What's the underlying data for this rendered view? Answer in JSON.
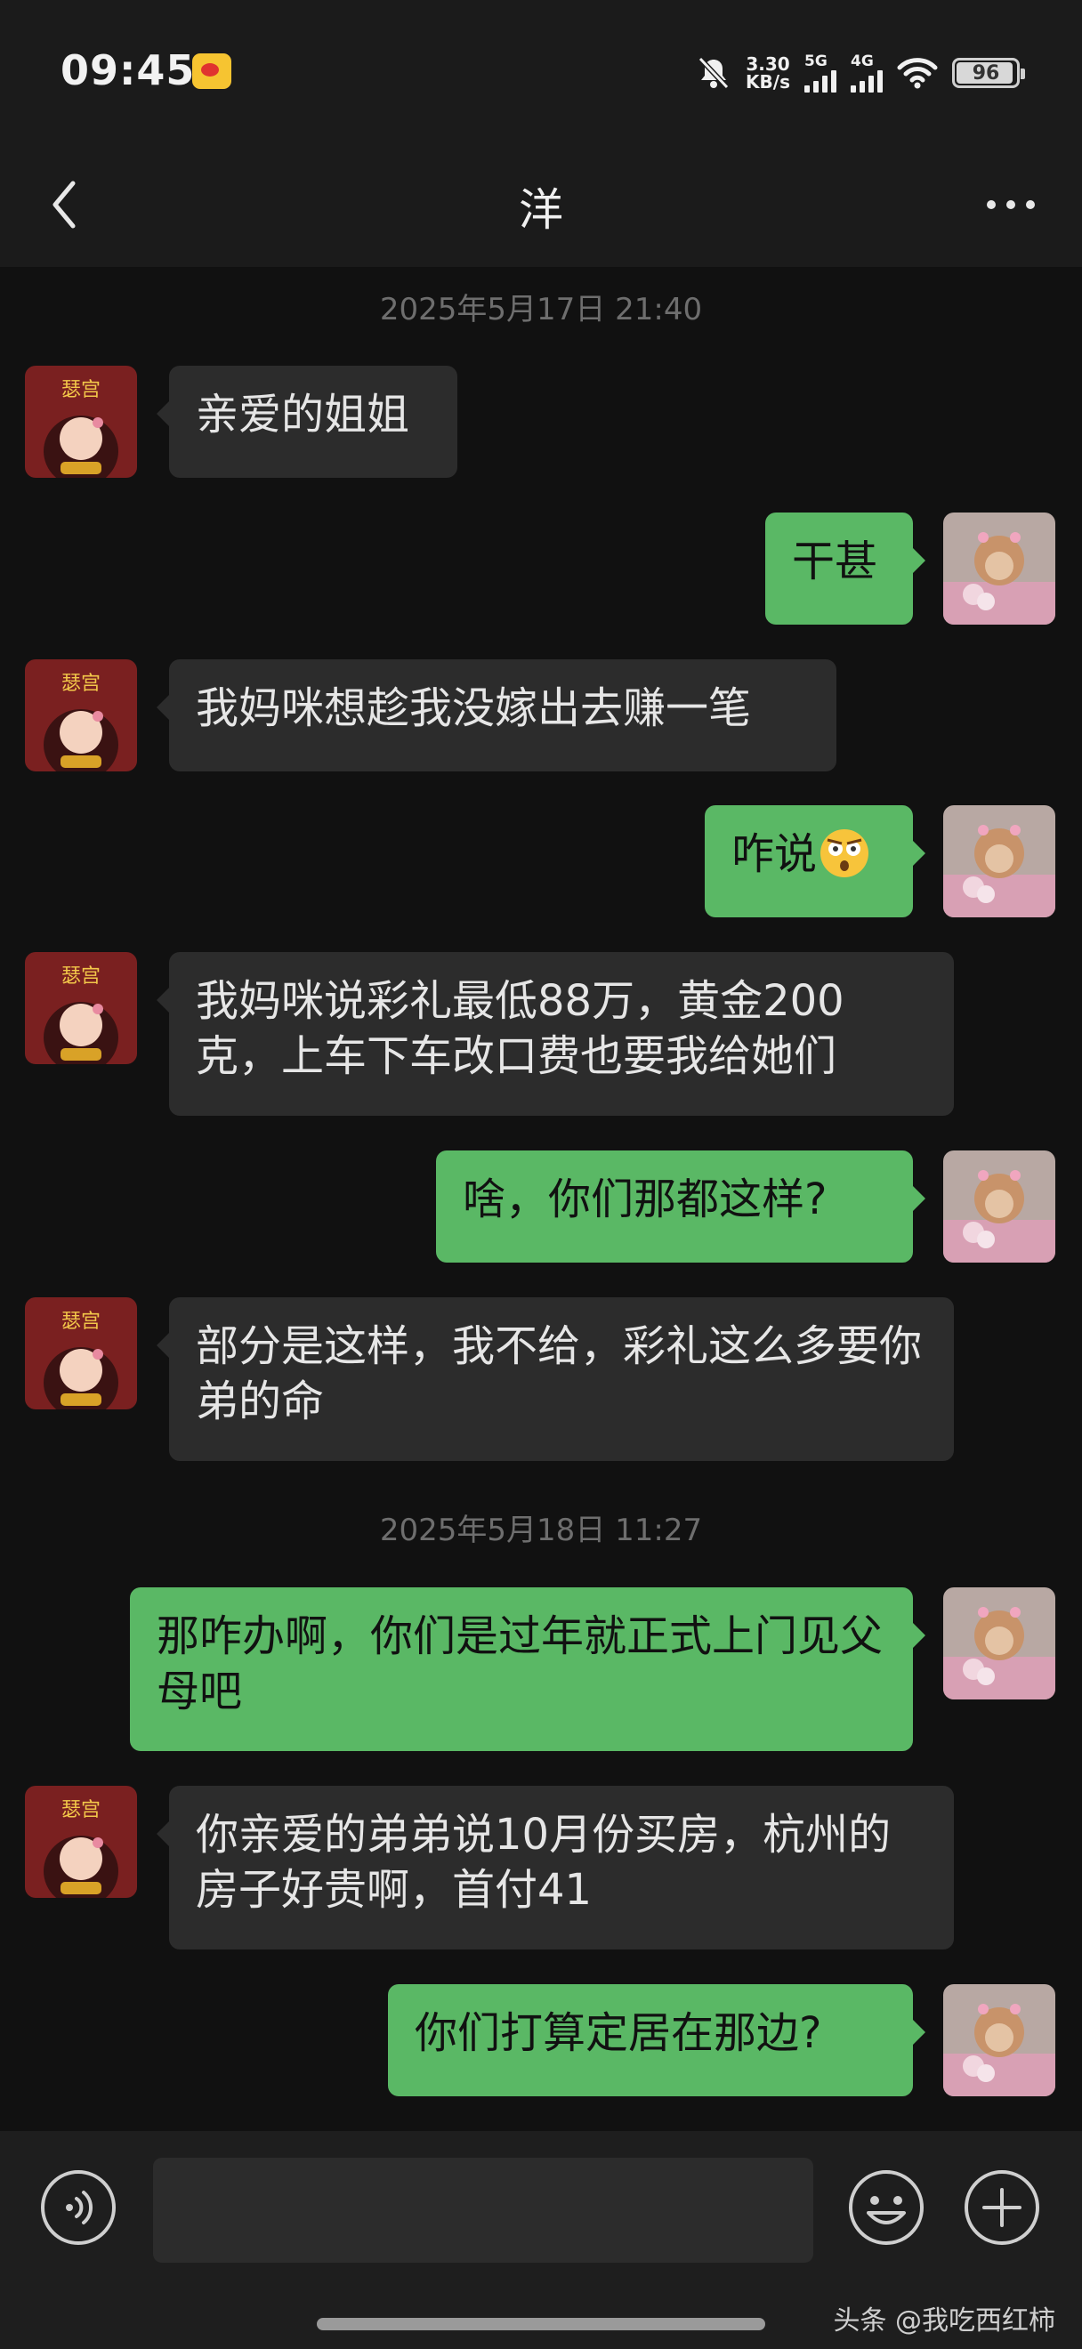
{
  "status_bar": {
    "time": "09:45",
    "net_speed": "3.30",
    "net_speed_unit": "KB/s",
    "sig1_label": "5G",
    "sig2_label": "4G",
    "battery": "96"
  },
  "header": {
    "title": "洋"
  },
  "chat": {
    "timestamps": [
      "2025年5月17日 21:40",
      "2025年5月18日 11:27"
    ],
    "messages": [
      {
        "side": "in",
        "text": "亲爱的姐姐"
      },
      {
        "side": "out",
        "text": "干甚"
      },
      {
        "side": "in",
        "text": "我妈咪想趁我没嫁出去赚一笔"
      },
      {
        "side": "out",
        "text": "咋说"
      },
      {
        "side": "in",
        "text": "我妈咪说彩礼最低88万，黄金200克，上车下车改口费也要我给她们"
      },
      {
        "side": "out",
        "text": "啥，你们那都这样?"
      },
      {
        "side": "in",
        "text": "部分是这样，我不给，彩礼这么多要你弟的命"
      },
      {
        "side": "out",
        "text": "那咋办啊，你们是过年就正式上门见父母吧"
      },
      {
        "side": "in",
        "text": "你亲爱的弟弟说10月份买房，杭州的房子好贵啊，首付41"
      },
      {
        "side": "out",
        "text": "你们打算定居在那边?"
      }
    ],
    "avatar_badge": "瑟宫"
  },
  "footer": {
    "watermark": "头条 @我吃西红柿"
  },
  "colors": {
    "bubble_out": "#5ab865",
    "bubble_in": "#2c2c2c",
    "background": "#111111"
  }
}
